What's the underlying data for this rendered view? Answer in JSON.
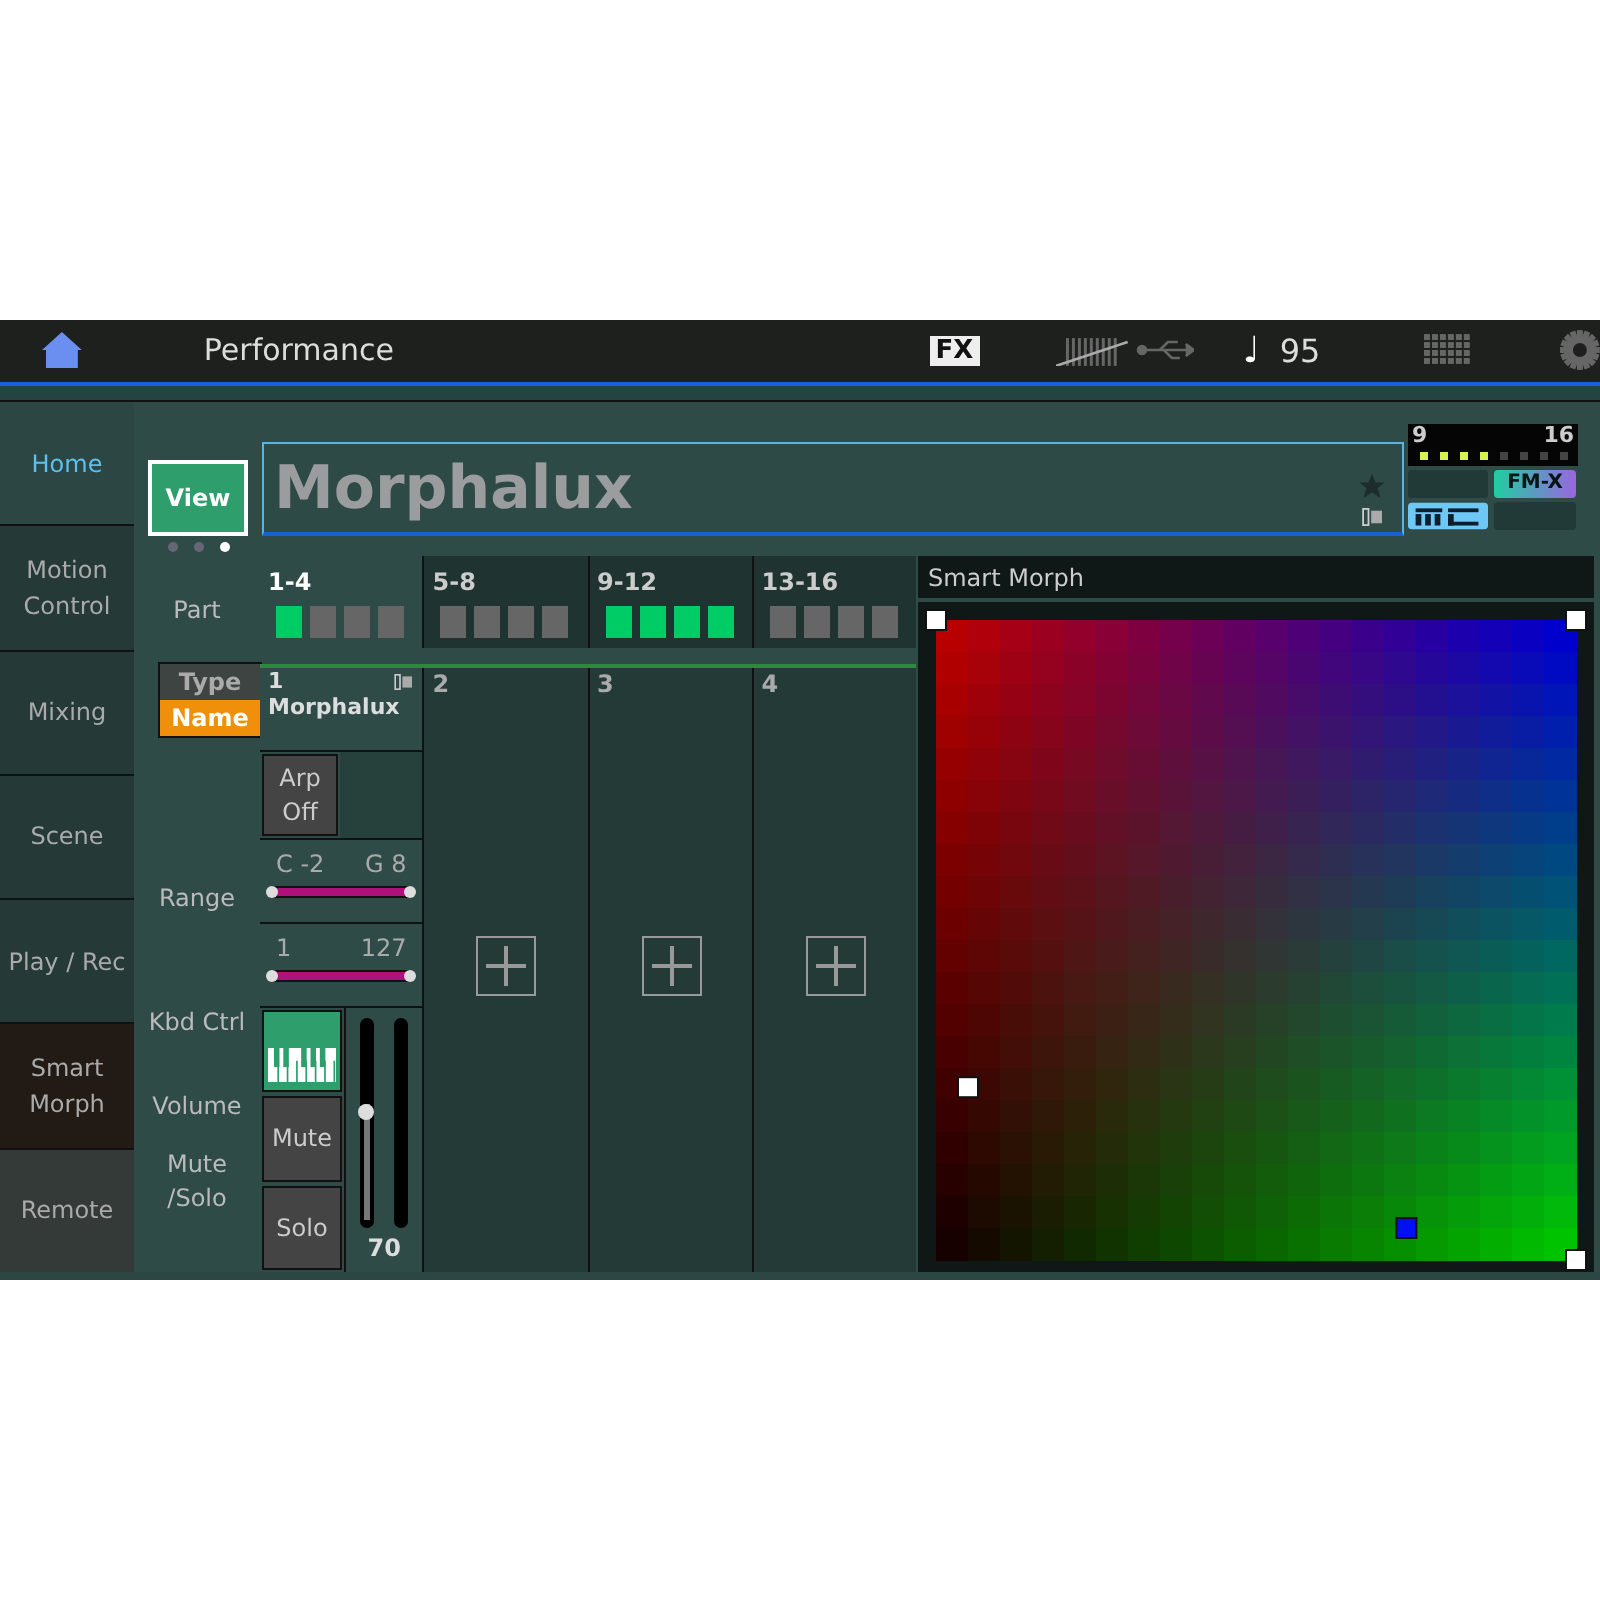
{
  "top_bar": {
    "title": "Performance",
    "fx": "FX",
    "note_glyph": "♩",
    "tempo": "95"
  },
  "sidebar": [
    {
      "label": "Home",
      "selected": true,
      "current": false
    },
    {
      "label": "Motion Control",
      "selected": false,
      "current": false
    },
    {
      "label": "Mixing",
      "selected": false,
      "current": false
    },
    {
      "label": "Scene",
      "selected": false,
      "current": false
    },
    {
      "label": "Play / Rec",
      "selected": false,
      "current": false
    },
    {
      "label": "Smart Morph",
      "selected": false,
      "current": true
    },
    {
      "label": "Remote",
      "selected": false,
      "current": false
    }
  ],
  "view_button": "View",
  "page_dots": [
    {
      "selected": false
    },
    {
      "selected": false
    },
    {
      "selected": true
    }
  ],
  "labels": {
    "part": "Part",
    "range": "Range",
    "kbd_ctrl": "Kbd Ctrl",
    "volume": "Volume",
    "mute_solo": "Mute /Solo"
  },
  "type_name_toggle": [
    {
      "label": "Type",
      "selected": false
    },
    {
      "label": "Name",
      "selected": true
    }
  ],
  "performance_name": "Morphalux",
  "status_box": {
    "from": "9",
    "to": "16",
    "leds": [
      true,
      true,
      true,
      true,
      false,
      false,
      false,
      false
    ],
    "badge": "FM-X"
  },
  "part_groups": [
    {
      "label": "1-4",
      "selected": true,
      "parts": [
        true,
        false,
        false,
        false
      ]
    },
    {
      "label": "5-8",
      "selected": false,
      "parts": [
        false,
        false,
        false,
        false
      ]
    },
    {
      "label": "9-12",
      "selected": false,
      "parts": [
        true,
        true,
        true,
        true
      ]
    },
    {
      "label": "13-16",
      "selected": false,
      "parts": [
        false,
        false,
        false,
        false
      ]
    }
  ],
  "parts": [
    {
      "kind": "part",
      "number": "1",
      "name": "Morphalux",
      "arp": "Arp Off",
      "note_low": "C -2",
      "note_high": "G 8",
      "note_slider": [
        {
          "level": 0
        },
        {
          "level": 1
        }
      ],
      "vel_low": "1",
      "vel_high": "127",
      "vel_slider": [
        {
          "level": 0
        },
        {
          "level": 1
        }
      ],
      "keyboard_on": true,
      "mute": "Mute",
      "solo": "Solo",
      "volume": "70",
      "level": 0.55
    },
    {
      "kind": "empty",
      "number": "2"
    },
    {
      "kind": "empty",
      "number": "3"
    },
    {
      "kind": "empty",
      "number": "4"
    }
  ],
  "smart_morph": {
    "title": "Smart Morph"
  }
}
